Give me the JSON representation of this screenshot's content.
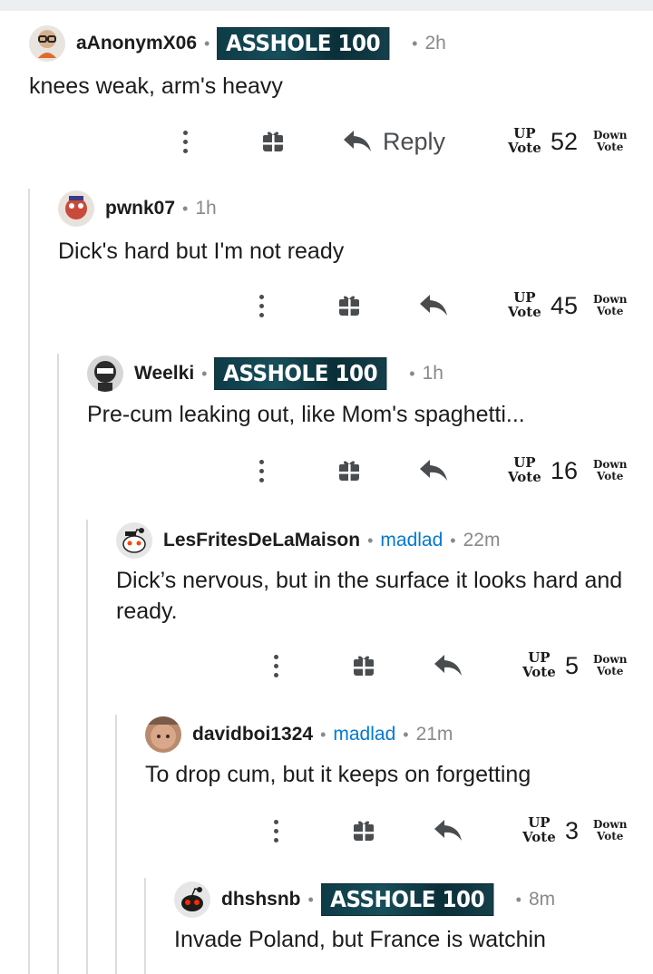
{
  "theme": {
    "flair_link_color": "#0079d3",
    "badge_color": "#0d3b46",
    "thread_line_color": "#dadce0"
  },
  "vote_labels": {
    "up_top": "UP",
    "up_bottom": "Vote",
    "down_top": "Down",
    "down_bottom": "Vote"
  },
  "comments": [
    {
      "username": "aAnonymX06",
      "flair": "ASSHOLE 100",
      "time": "2h",
      "text": "knees weak, arm's heavy",
      "reply_label": "Reply",
      "score": "52",
      "avatar_icon": "cartoon-glasses-avatar-icon"
    },
    {
      "username": "pwnk07",
      "time": "1h",
      "text": "Dick's hard but I'm not ready",
      "score": "45",
      "avatar_icon": "cartoon-avatar-icon"
    },
    {
      "username": "Weelki",
      "flair": "ASSHOLE 100",
      "time": "1h",
      "text": "Pre-cum leaking out, like Mom's spaghetti...",
      "score": "16",
      "avatar_icon": "dark-avatar-icon"
    },
    {
      "username": "LesFritesDeLaMaison",
      "flair": "madlad",
      "time": "22m",
      "text": "Dick’s nervous, but in the surface it looks hard and ready.",
      "score": "5",
      "avatar_icon": "snoo-avatar-icon"
    },
    {
      "username": "davidboi1324",
      "flair": "madlad",
      "time": "21m",
      "text": "To drop cum, but it keeps on forgetting",
      "score": "3",
      "avatar_icon": "photo-avatar-icon"
    },
    {
      "username": "dhshsnb",
      "flair": "ASSHOLE 100",
      "time": "8m",
      "text": "Invade Poland, but France is watchin",
      "avatar_icon": "snoo-red-eye-avatar-icon"
    }
  ]
}
